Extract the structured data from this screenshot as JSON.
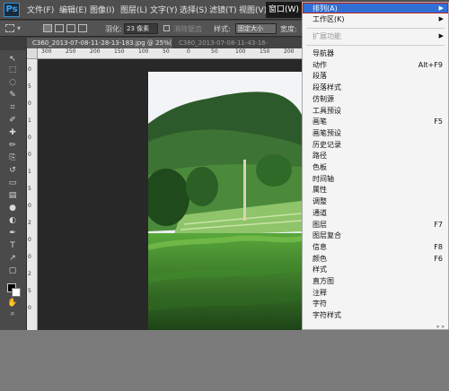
{
  "app": {
    "logo": "Ps"
  },
  "menubar": {
    "items": [
      "文件(F)",
      "编辑(E)",
      "图像(I)",
      "图层(L)",
      "文字(Y)",
      "选择(S)",
      "滤镜(T)",
      "视图(V)",
      "窗口(W)"
    ],
    "active_index": 8
  },
  "options": {
    "feather_label": "羽化:",
    "feather_value": "23 像素",
    "antialias_label": "消除锯齿",
    "style_label": "样式:",
    "style_value": "固定大小",
    "width_label": "宽度:"
  },
  "tabs": [
    {
      "label": "C360_2013-07-08-11-28-13-183.jpg @ 25%(RGB/8#)",
      "close": "×"
    },
    {
      "label": "C360_2013-07-08-11-43-16-",
      "close": ""
    }
  ],
  "ruler": {
    "top": [
      "300",
      "250",
      "200",
      "150",
      "100",
      "50",
      "0",
      "50",
      "100",
      "150",
      "200"
    ],
    "left": [
      "0",
      "5",
      "0",
      "1",
      "0",
      "0",
      "1",
      "5",
      "0",
      "2",
      "0",
      "0",
      "2",
      "5",
      "0"
    ]
  },
  "toolbox": {
    "tools": [
      "move-tool-icon",
      "marquee-tool-icon",
      "lasso-tool-icon",
      "quick-select-tool-icon",
      "crop-tool-icon",
      "eyedropper-tool-icon",
      "healing-tool-icon",
      "brush-tool-icon",
      "clone-stamp-tool-icon",
      "history-brush-tool-icon",
      "eraser-tool-icon",
      "gradient-tool-icon",
      "blur-tool-icon",
      "dodge-tool-icon",
      "pen-tool-icon",
      "type-tool-icon",
      "path-select-tool-icon",
      "shape-tool-icon",
      "hand-tool-icon",
      "zoom-tool-icon"
    ],
    "glyphs": [
      "↖",
      "⬚",
      "◌",
      "✎",
      "⌗",
      "✐",
      "✚",
      "✏",
      "⎘",
      "↺",
      "▭",
      "▤",
      "●",
      "◐",
      "✒",
      "T",
      "↗",
      "▢",
      "✋",
      "⌕"
    ]
  },
  "window_menu": {
    "items": [
      {
        "label": "排列(A)",
        "highlight": true,
        "arrow": "▶"
      },
      {
        "label": "工作区(K)",
        "arrow": "▶"
      },
      {
        "sep": true
      },
      {
        "label": "扩展功能",
        "disabled": true,
        "arrow": "▶"
      },
      {
        "sep": true
      },
      {
        "label": "导航器"
      },
      {
        "label": "动作",
        "shortcut": "Alt+F9"
      },
      {
        "label": "段落"
      },
      {
        "label": "段落样式"
      },
      {
        "label": "仿制源"
      },
      {
        "label": "工具预设"
      },
      {
        "label": "画笔",
        "shortcut": "F5"
      },
      {
        "label": "画笔预设"
      },
      {
        "label": "历史记录"
      },
      {
        "label": "路径"
      },
      {
        "label": "色板"
      },
      {
        "label": "时间轴"
      },
      {
        "label": "属性"
      },
      {
        "label": "调整"
      },
      {
        "label": "通道"
      },
      {
        "label": "图层",
        "shortcut": "F7"
      },
      {
        "label": "图层复合"
      },
      {
        "label": "信息",
        "shortcut": "F8"
      },
      {
        "label": "颜色",
        "shortcut": "F6"
      },
      {
        "label": "样式"
      },
      {
        "label": "直方图"
      },
      {
        "label": "注释"
      },
      {
        "label": "字符"
      },
      {
        "label": "字符样式"
      }
    ],
    "scroll_glyph": "» »"
  },
  "colors": {
    "menubar": "#4f4f4f",
    "menu_highlight": "#2f6fd6",
    "highlight_border": "#c02020",
    "canvas_bg": "#282828",
    "desktop": "#7a7a7a"
  }
}
